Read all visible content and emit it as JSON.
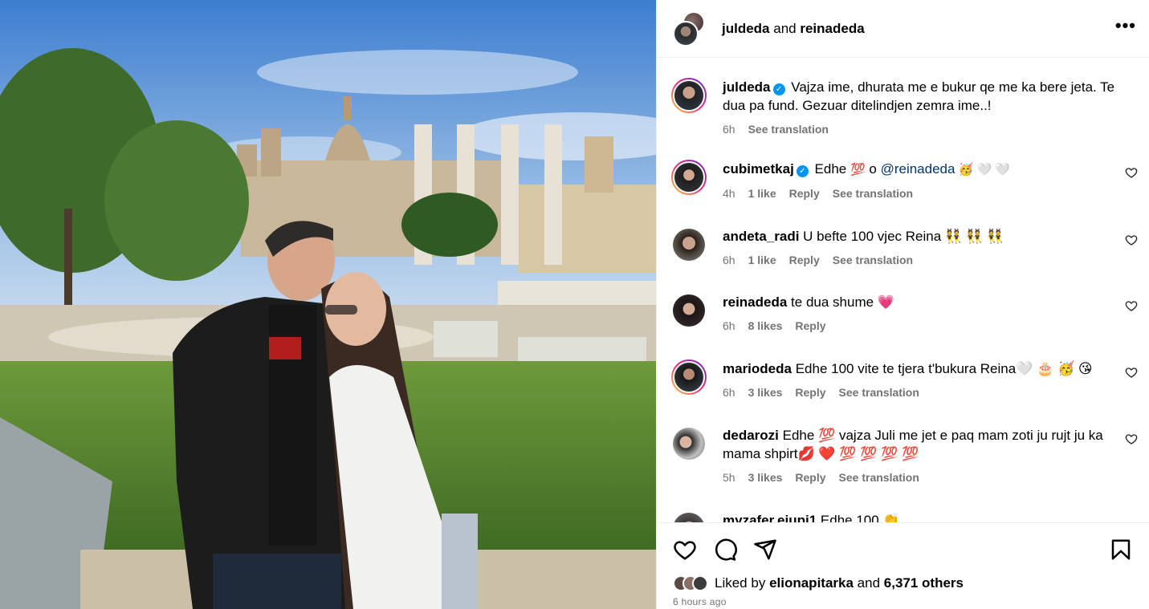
{
  "header": {
    "user1": "juldeda",
    "and": "and",
    "user2": "reinadeda",
    "more": "•••"
  },
  "caption": {
    "username": "juldeda",
    "text": "Vajza ime, dhurata me e bukur qe me ka bere jeta. Te dua pa fund. Gezuar ditelindjen zemra ime..!",
    "time": "6h",
    "see_translation": "See translation"
  },
  "comments": [
    {
      "username": "cubimetkaj",
      "verified": true,
      "text_pre": "Edhe ",
      "emoji1": "💯",
      "text_mid": " o ",
      "mention": "@reinadeda",
      "text_post": " 🥳 🤍 🤍",
      "time": "4h",
      "likes": "1 like",
      "reply": "Reply",
      "translate": "See translation"
    },
    {
      "username": "andeta_radi",
      "text": "U befte 100 vjec Reina 👯 👯 👯",
      "time": "6h",
      "likes": "1 like",
      "reply": "Reply",
      "translate": "See translation"
    },
    {
      "username": "reinadeda",
      "text": "te dua shume 💗",
      "time": "6h",
      "likes": "8 likes",
      "reply": "Reply"
    },
    {
      "username": "mariodeda",
      "text": "Edhe 100 vite te tjera t'bukura Reina🤍 🎂 🥳 😘",
      "time": "6h",
      "likes": "3 likes",
      "reply": "Reply",
      "translate": "See translation"
    },
    {
      "username": "dedarozi",
      "text": "Edhe 💯 vajza Juli me jet e paq mam zoti ju rujt ju ka mama shpirt💋 ❤️ 💯 💯 💯 💯",
      "time": "5h",
      "likes": "3 likes",
      "reply": "Reply",
      "translate": "See translation"
    },
    {
      "username": "myzafer.ejupi1",
      "text": "Edhe 100 👏"
    }
  ],
  "footer": {
    "liked_by": "Liked by",
    "liker": "elionapitarka",
    "and": "and",
    "others": "6,371 others",
    "ago": "6 hours ago"
  },
  "colors": {
    "verified": "#0095f6",
    "muted": "#737373",
    "mention": "#00376b"
  },
  "icons": [
    "more-icon",
    "verified-icon",
    "heart-icon",
    "comment-icon",
    "share-icon",
    "bookmark-icon"
  ]
}
